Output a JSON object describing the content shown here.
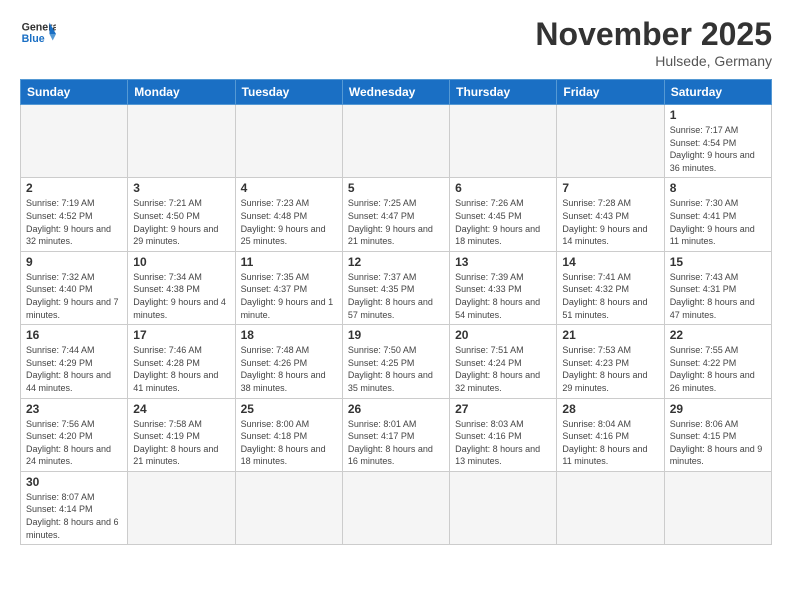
{
  "header": {
    "logo_general": "General",
    "logo_blue": "Blue",
    "month_title": "November 2025",
    "location": "Hulsede, Germany"
  },
  "weekdays": [
    "Sunday",
    "Monday",
    "Tuesday",
    "Wednesday",
    "Thursday",
    "Friday",
    "Saturday"
  ],
  "weeks": [
    [
      {
        "day": "",
        "info": ""
      },
      {
        "day": "",
        "info": ""
      },
      {
        "day": "",
        "info": ""
      },
      {
        "day": "",
        "info": ""
      },
      {
        "day": "",
        "info": ""
      },
      {
        "day": "",
        "info": ""
      },
      {
        "day": "1",
        "info": "Sunrise: 7:17 AM\nSunset: 4:54 PM\nDaylight: 9 hours and 36 minutes."
      }
    ],
    [
      {
        "day": "2",
        "info": "Sunrise: 7:19 AM\nSunset: 4:52 PM\nDaylight: 9 hours and 32 minutes."
      },
      {
        "day": "3",
        "info": "Sunrise: 7:21 AM\nSunset: 4:50 PM\nDaylight: 9 hours and 29 minutes."
      },
      {
        "day": "4",
        "info": "Sunrise: 7:23 AM\nSunset: 4:48 PM\nDaylight: 9 hours and 25 minutes."
      },
      {
        "day": "5",
        "info": "Sunrise: 7:25 AM\nSunset: 4:47 PM\nDaylight: 9 hours and 21 minutes."
      },
      {
        "day": "6",
        "info": "Sunrise: 7:26 AM\nSunset: 4:45 PM\nDaylight: 9 hours and 18 minutes."
      },
      {
        "day": "7",
        "info": "Sunrise: 7:28 AM\nSunset: 4:43 PM\nDaylight: 9 hours and 14 minutes."
      },
      {
        "day": "8",
        "info": "Sunrise: 7:30 AM\nSunset: 4:41 PM\nDaylight: 9 hours and 11 minutes."
      }
    ],
    [
      {
        "day": "9",
        "info": "Sunrise: 7:32 AM\nSunset: 4:40 PM\nDaylight: 9 hours and 7 minutes."
      },
      {
        "day": "10",
        "info": "Sunrise: 7:34 AM\nSunset: 4:38 PM\nDaylight: 9 hours and 4 minutes."
      },
      {
        "day": "11",
        "info": "Sunrise: 7:35 AM\nSunset: 4:37 PM\nDaylight: 9 hours and 1 minute."
      },
      {
        "day": "12",
        "info": "Sunrise: 7:37 AM\nSunset: 4:35 PM\nDaylight: 8 hours and 57 minutes."
      },
      {
        "day": "13",
        "info": "Sunrise: 7:39 AM\nSunset: 4:33 PM\nDaylight: 8 hours and 54 minutes."
      },
      {
        "day": "14",
        "info": "Sunrise: 7:41 AM\nSunset: 4:32 PM\nDaylight: 8 hours and 51 minutes."
      },
      {
        "day": "15",
        "info": "Sunrise: 7:43 AM\nSunset: 4:31 PM\nDaylight: 8 hours and 47 minutes."
      }
    ],
    [
      {
        "day": "16",
        "info": "Sunrise: 7:44 AM\nSunset: 4:29 PM\nDaylight: 8 hours and 44 minutes."
      },
      {
        "day": "17",
        "info": "Sunrise: 7:46 AM\nSunset: 4:28 PM\nDaylight: 8 hours and 41 minutes."
      },
      {
        "day": "18",
        "info": "Sunrise: 7:48 AM\nSunset: 4:26 PM\nDaylight: 8 hours and 38 minutes."
      },
      {
        "day": "19",
        "info": "Sunrise: 7:50 AM\nSunset: 4:25 PM\nDaylight: 8 hours and 35 minutes."
      },
      {
        "day": "20",
        "info": "Sunrise: 7:51 AM\nSunset: 4:24 PM\nDaylight: 8 hours and 32 minutes."
      },
      {
        "day": "21",
        "info": "Sunrise: 7:53 AM\nSunset: 4:23 PM\nDaylight: 8 hours and 29 minutes."
      },
      {
        "day": "22",
        "info": "Sunrise: 7:55 AM\nSunset: 4:22 PM\nDaylight: 8 hours and 26 minutes."
      }
    ],
    [
      {
        "day": "23",
        "info": "Sunrise: 7:56 AM\nSunset: 4:20 PM\nDaylight: 8 hours and 24 minutes."
      },
      {
        "day": "24",
        "info": "Sunrise: 7:58 AM\nSunset: 4:19 PM\nDaylight: 8 hours and 21 minutes."
      },
      {
        "day": "25",
        "info": "Sunrise: 8:00 AM\nSunset: 4:18 PM\nDaylight: 8 hours and 18 minutes."
      },
      {
        "day": "26",
        "info": "Sunrise: 8:01 AM\nSunset: 4:17 PM\nDaylight: 8 hours and 16 minutes."
      },
      {
        "day": "27",
        "info": "Sunrise: 8:03 AM\nSunset: 4:16 PM\nDaylight: 8 hours and 13 minutes."
      },
      {
        "day": "28",
        "info": "Sunrise: 8:04 AM\nSunset: 4:16 PM\nDaylight: 8 hours and 11 minutes."
      },
      {
        "day": "29",
        "info": "Sunrise: 8:06 AM\nSunset: 4:15 PM\nDaylight: 8 hours and 9 minutes."
      }
    ],
    [
      {
        "day": "30",
        "info": "Sunrise: 8:07 AM\nSunset: 4:14 PM\nDaylight: 8 hours and 6 minutes."
      },
      {
        "day": "",
        "info": ""
      },
      {
        "day": "",
        "info": ""
      },
      {
        "day": "",
        "info": ""
      },
      {
        "day": "",
        "info": ""
      },
      {
        "day": "",
        "info": ""
      },
      {
        "day": "",
        "info": ""
      }
    ]
  ]
}
